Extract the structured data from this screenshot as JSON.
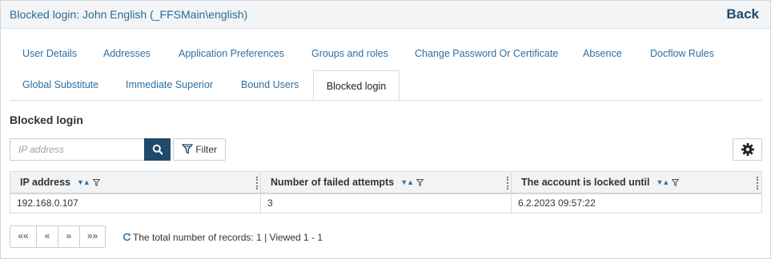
{
  "header": {
    "title": "Blocked login: John English (_FFSMain\\english)",
    "back_label": "Back"
  },
  "tabs": [
    {
      "label": "User Details"
    },
    {
      "label": "Addresses"
    },
    {
      "label": "Application Preferences"
    },
    {
      "label": "Groups and roles"
    },
    {
      "label": "Change Password Or Certificate"
    },
    {
      "label": "Absence"
    },
    {
      "label": "Docflow Rules"
    },
    {
      "label": "Global Substitute"
    },
    {
      "label": "Immediate Superior"
    },
    {
      "label": "Bound Users"
    },
    {
      "label": "Blocked login",
      "active": true
    }
  ],
  "section": {
    "title": "Blocked login"
  },
  "search": {
    "placeholder": "IP address",
    "value": ""
  },
  "filter": {
    "label": "Filter"
  },
  "table": {
    "columns": [
      "IP address",
      "Number of failed attempts",
      "The account is locked until"
    ],
    "rows": [
      [
        "192.168.0.107",
        "3",
        "6.2.2023 09:57:22"
      ]
    ]
  },
  "pager": {
    "first": "««",
    "prev": "«",
    "next": "»",
    "last": "»»"
  },
  "status": {
    "records_text": "The total number of records: 1 | Viewed 1 - 1"
  },
  "colors": {
    "accent": "#1f4a6b",
    "link": "#2d6fa0",
    "header_bg": "#f2f4f6"
  },
  "icons": {
    "search": "search-icon",
    "filter": "funnel-icon",
    "settings": "gear-icon",
    "refresh": "refresh-icon"
  }
}
